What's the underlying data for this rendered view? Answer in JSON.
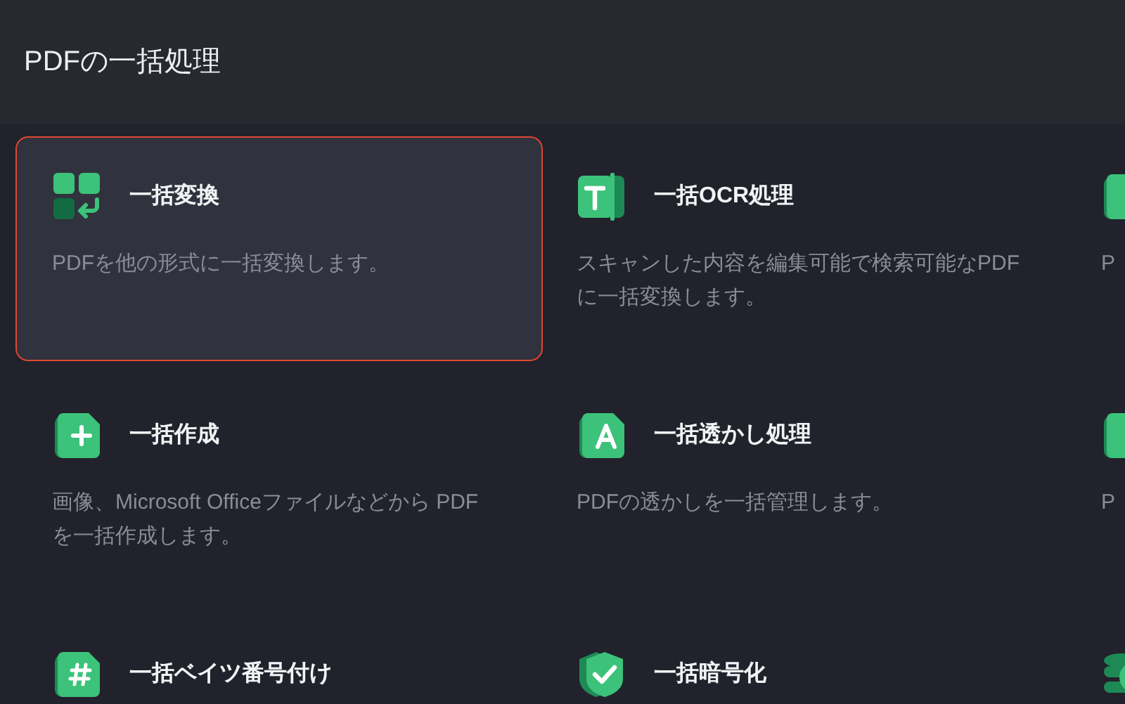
{
  "header": {
    "title": "PDFの一括処理"
  },
  "cards": [
    {
      "kind": "convert",
      "title": "一括変換",
      "description": "PDFを他の形式に一括変換します。",
      "selected": true
    },
    {
      "kind": "ocr",
      "title": "一括OCR処理",
      "description": "スキャンした内容を編集可能で検索可能なPDFに一括変換します。",
      "selected": false
    },
    {
      "kind": "doc",
      "description": "P",
      "selected": false
    },
    {
      "kind": "create",
      "title": "一括作成",
      "description": "画像、Microsoft Officeファイルなどから PDF を一括作成します。",
      "selected": false
    },
    {
      "kind": "watermark",
      "title": "一括透かし処理",
      "description": "PDFの透かしを一括管理します。",
      "selected": false
    },
    {
      "kind": "doc",
      "description": "P",
      "selected": false
    },
    {
      "kind": "bates",
      "title": "一括ベイツ番号付け",
      "selected": false
    },
    {
      "kind": "encrypt",
      "title": "一括暗号化",
      "selected": false
    },
    {
      "kind": "stack",
      "selected": false
    }
  ]
}
